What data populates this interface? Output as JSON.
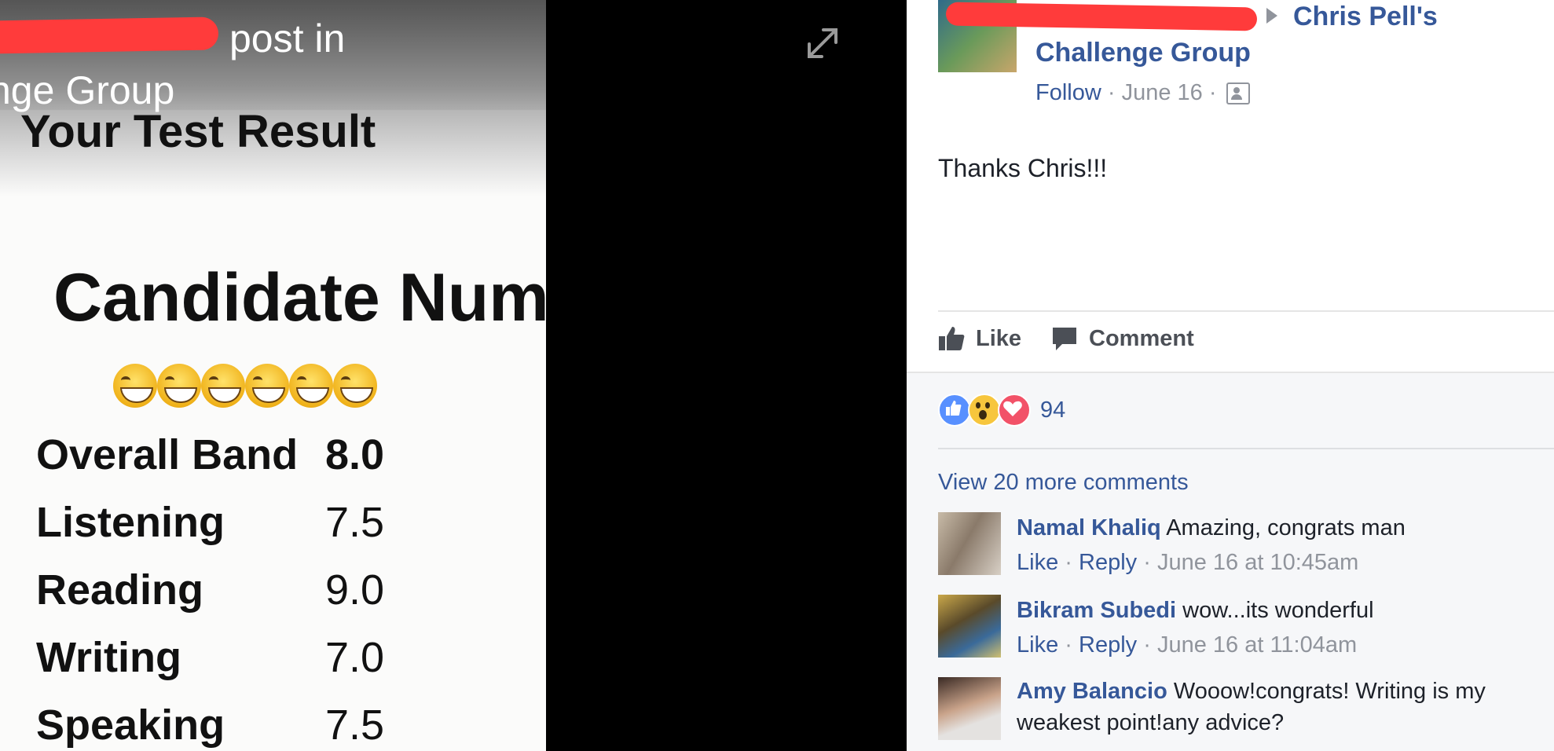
{
  "photo": {
    "caption_line1": "post in",
    "caption_line2": "nge Group",
    "title": "Your Test Result",
    "candidate_label": "Candidate Num",
    "scores": [
      {
        "name": "Overall Band",
        "value": "8.0"
      },
      {
        "name": "Listening",
        "value": "7.5"
      },
      {
        "name": "Reading",
        "value": "9.0"
      },
      {
        "name": "Writing",
        "value": "7.0"
      },
      {
        "name": "Speaking",
        "value": "7.5"
      }
    ],
    "emoji_name": "grinning-face-icon",
    "emoji_count": 6
  },
  "viewer": {
    "expand_icon": "expand-icon"
  },
  "post": {
    "group_line1": "Chris Pell's",
    "group_line2": "Challenge Group",
    "follow_label": "Follow",
    "separator": " · ",
    "date": "June 16",
    "audience_icon": "group-audience-icon",
    "text": "Thanks Chris!!!"
  },
  "actions": {
    "like_label": "Like",
    "comment_label": "Comment"
  },
  "reactions": {
    "count": "94",
    "types": [
      "like",
      "wow",
      "love"
    ],
    "colors": {
      "like": "#5890ff",
      "wow": "#f7c63d",
      "love": "#f25268"
    }
  },
  "comments_section": {
    "view_more": "View 20 more comments",
    "items": [
      {
        "author": "Namal Khaliq",
        "text": "Amazing, congrats man",
        "like": "Like",
        "reply": "Reply",
        "time": "June 16 at 10:45am"
      },
      {
        "author": "Bikram Subedi",
        "text": "wow...its wonderful",
        "like": "Like",
        "reply": "Reply",
        "time": "June 16 at 11:04am"
      },
      {
        "author": "Amy Balancio",
        "text": "Wooow!congrats! Writing is my weakest point!any advice?"
      }
    ]
  },
  "colors": {
    "link": "#365899",
    "meta": "#90949c",
    "redaction": "#ff3b3b",
    "viewer_bg": "#000000"
  }
}
